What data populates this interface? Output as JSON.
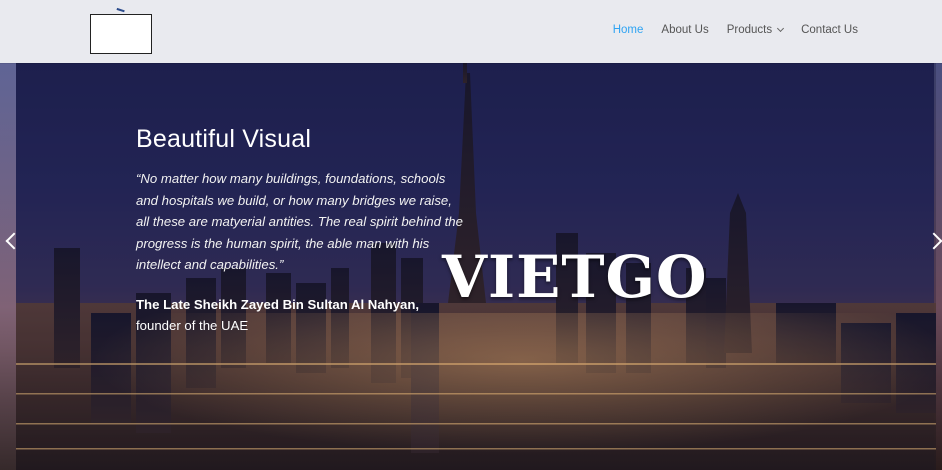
{
  "header": {
    "logo_alt": "",
    "nav": [
      {
        "label": "Home",
        "active": true
      },
      {
        "label": "About Us",
        "active": false
      },
      {
        "label": "Products",
        "active": false,
        "has_dropdown": true
      },
      {
        "label": "Contact Us",
        "active": false
      }
    ],
    "accent_color": "#2ea3f2"
  },
  "slide": {
    "title": "Beautiful Visual",
    "quote": "“No matter how many buildings, foundations, schools and hospitals we build, or how many bridges we raise, all these are matyerial antities. The real spirit behind the progress is the human spirit, the able man with his intellect and capabilities.”",
    "author": "The Late Sheikh Zayed Bin Sultan Al Nahyan,",
    "author_role": "founder of the UAE"
  },
  "watermark": "VIETGO",
  "controls": {
    "prev_icon": "chevron-left-icon",
    "next_icon": "chevron-right-icon"
  }
}
